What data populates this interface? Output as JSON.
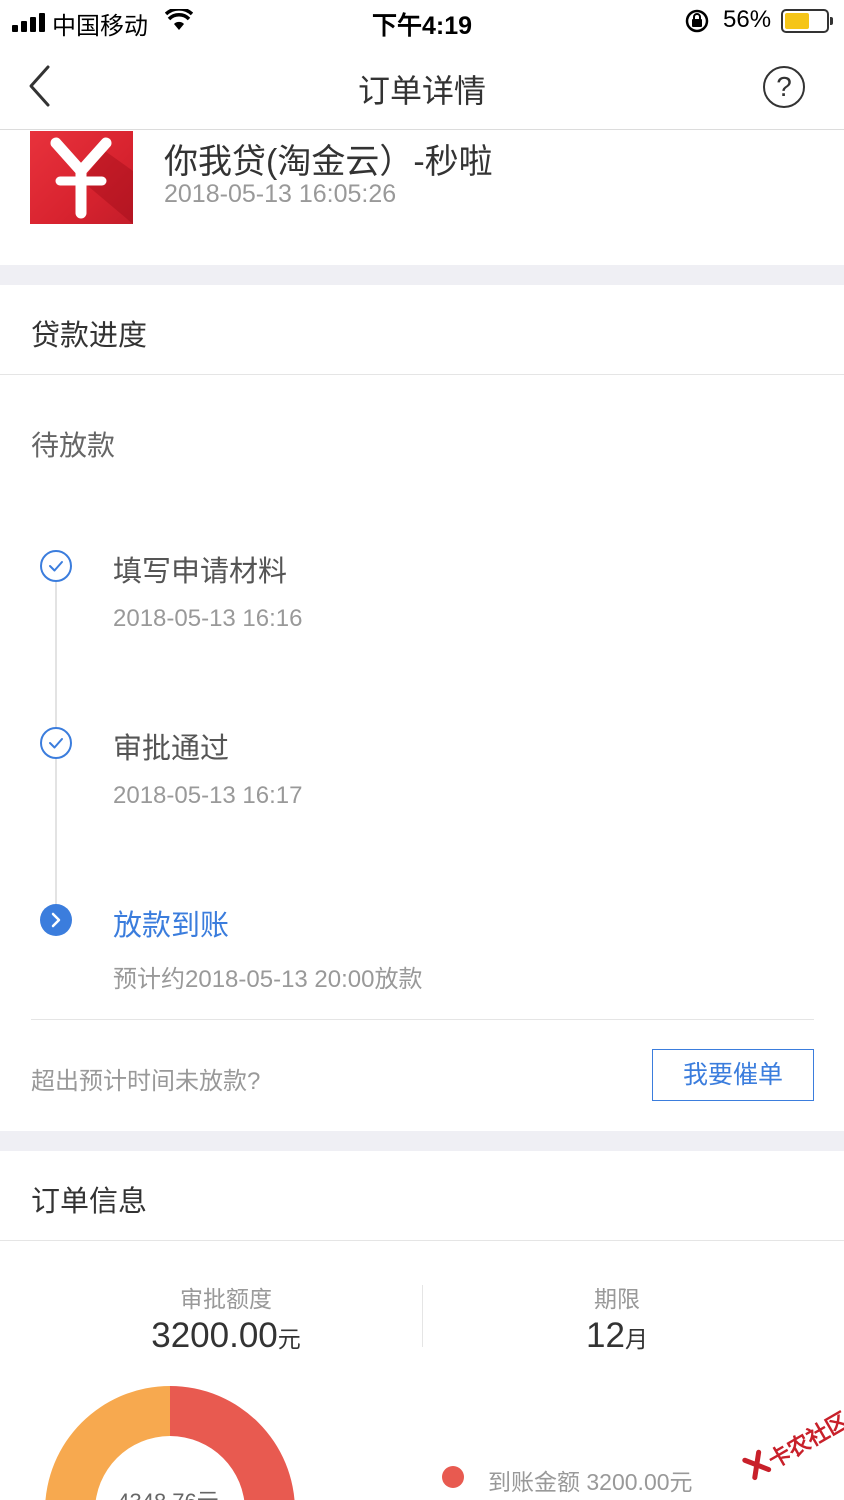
{
  "status_bar": {
    "carrier": "中国移动",
    "time": "下午4:19",
    "battery_percent": "56%",
    "battery_level": 0.56,
    "battery_color": "#f5c518"
  },
  "nav": {
    "back_icon": "chevron-left-icon",
    "title": "订单详情",
    "help_icon": "question-circle-icon",
    "help_glyph": "?"
  },
  "product": {
    "logo_glyph": "¥",
    "logo_color": "#e2303a",
    "name": "你我贷(淘金云）-秒啦",
    "time": "2018-05-13 16:05:26"
  },
  "progress": {
    "section_title": "贷款进度",
    "status": "待放款",
    "steps": [
      {
        "label": "填写申请材料",
        "time": "2018-05-13 16:16",
        "state": "done",
        "icon": "check-circle-icon"
      },
      {
        "label": "审批通过",
        "time": "2018-05-13 16:17",
        "state": "done",
        "icon": "check-circle-icon"
      },
      {
        "label": "放款到账",
        "time": "预计约2018-05-13 20:00放款",
        "state": "active",
        "icon": "chevron-right-circle-icon"
      }
    ],
    "overdue_question": "超出预计时间未放款?",
    "urge_button": "我要催单",
    "accent_color": "#3b7ddd"
  },
  "order_info": {
    "section_title": "订单信息",
    "amount_label": "审批额度",
    "amount_value": "3200.00",
    "amount_unit": "元",
    "term_label": "期限",
    "term_value": "12",
    "term_unit": "月",
    "donut_center": "4348.76元",
    "legend": [
      {
        "label": "到账金额 3200.00元",
        "color": "#e85a50"
      }
    ],
    "donut_colors": {
      "received": "#e85a50",
      "other": "#f7a94f"
    }
  },
  "watermark": {
    "text": "卡农社区"
  }
}
